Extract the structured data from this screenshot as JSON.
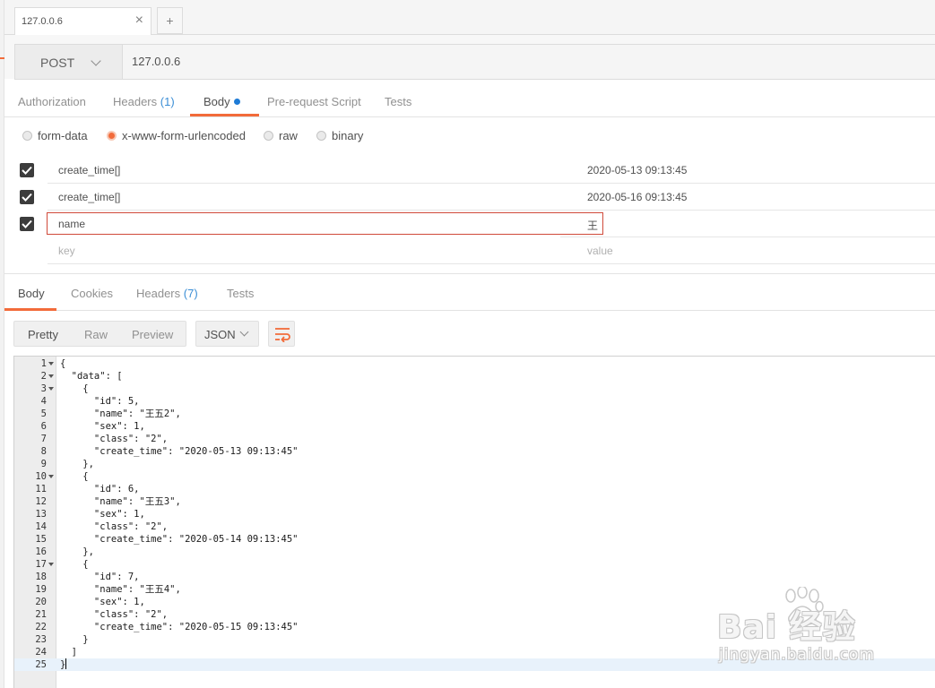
{
  "tabs": [
    {
      "label": "127.0.0.6",
      "close": "×"
    }
  ],
  "new_tab": "+",
  "request": {
    "method": "POST",
    "url": "127.0.0.6"
  },
  "request_tabs": {
    "authorization": "Authorization",
    "headers": "Headers",
    "headers_count": "(1)",
    "body": "Body",
    "prerequest": "Pre-request Script",
    "tests": "Tests"
  },
  "body_modes": {
    "form_data": "form-data",
    "urlencoded": "x-www-form-urlencoded",
    "raw": "raw",
    "binary": "binary",
    "selected": "x-www-form-urlencoded"
  },
  "params": [
    {
      "checked": true,
      "key": "create_time[]",
      "value": "2020-05-13 09:13:45"
    },
    {
      "checked": true,
      "key": "create_time[]",
      "value": "2020-05-16 09:13:45"
    },
    {
      "checked": true,
      "key": "name",
      "value": "王"
    }
  ],
  "params_placeholder": {
    "key": "key",
    "value": "value"
  },
  "response_tabs": {
    "body": "Body",
    "cookies": "Cookies",
    "headers": "Headers",
    "headers_count": "(7)",
    "tests": "Tests"
  },
  "response_view": {
    "pretty": "Pretty",
    "raw": "Raw",
    "preview": "Preview",
    "format": "JSON"
  },
  "code_lines": [
    "{",
    "  \"data\": [",
    "    {",
    "      \"id\": 5,",
    "      \"name\": \"王五2\",",
    "      \"sex\": 1,",
    "      \"class\": \"2\",",
    "      \"create_time\": \"2020-05-13 09:13:45\"",
    "    },",
    "    {",
    "      \"id\": 6,",
    "      \"name\": \"王五3\",",
    "      \"sex\": 1,",
    "      \"class\": \"2\",",
    "      \"create_time\": \"2020-05-14 09:13:45\"",
    "    },",
    "    {",
    "      \"id\": 7,",
    "      \"name\": \"王五4\",",
    "      \"sex\": 1,",
    "      \"class\": \"2\",",
    "      \"create_time\": \"2020-05-15 09:13:45\"",
    "    }",
    "  ]",
    "}"
  ],
  "fold_lines": [
    1,
    2,
    3,
    10,
    17
  ],
  "current_line": 25,
  "watermark": {
    "brand": "Bai 经验",
    "site": "jingyan.baidu.com"
  },
  "colors": {
    "accent": "#f26b3a",
    "link_blue": "#3b8ed6",
    "dot_blue": "#1e7bd6",
    "error_border": "#d04a3a"
  }
}
